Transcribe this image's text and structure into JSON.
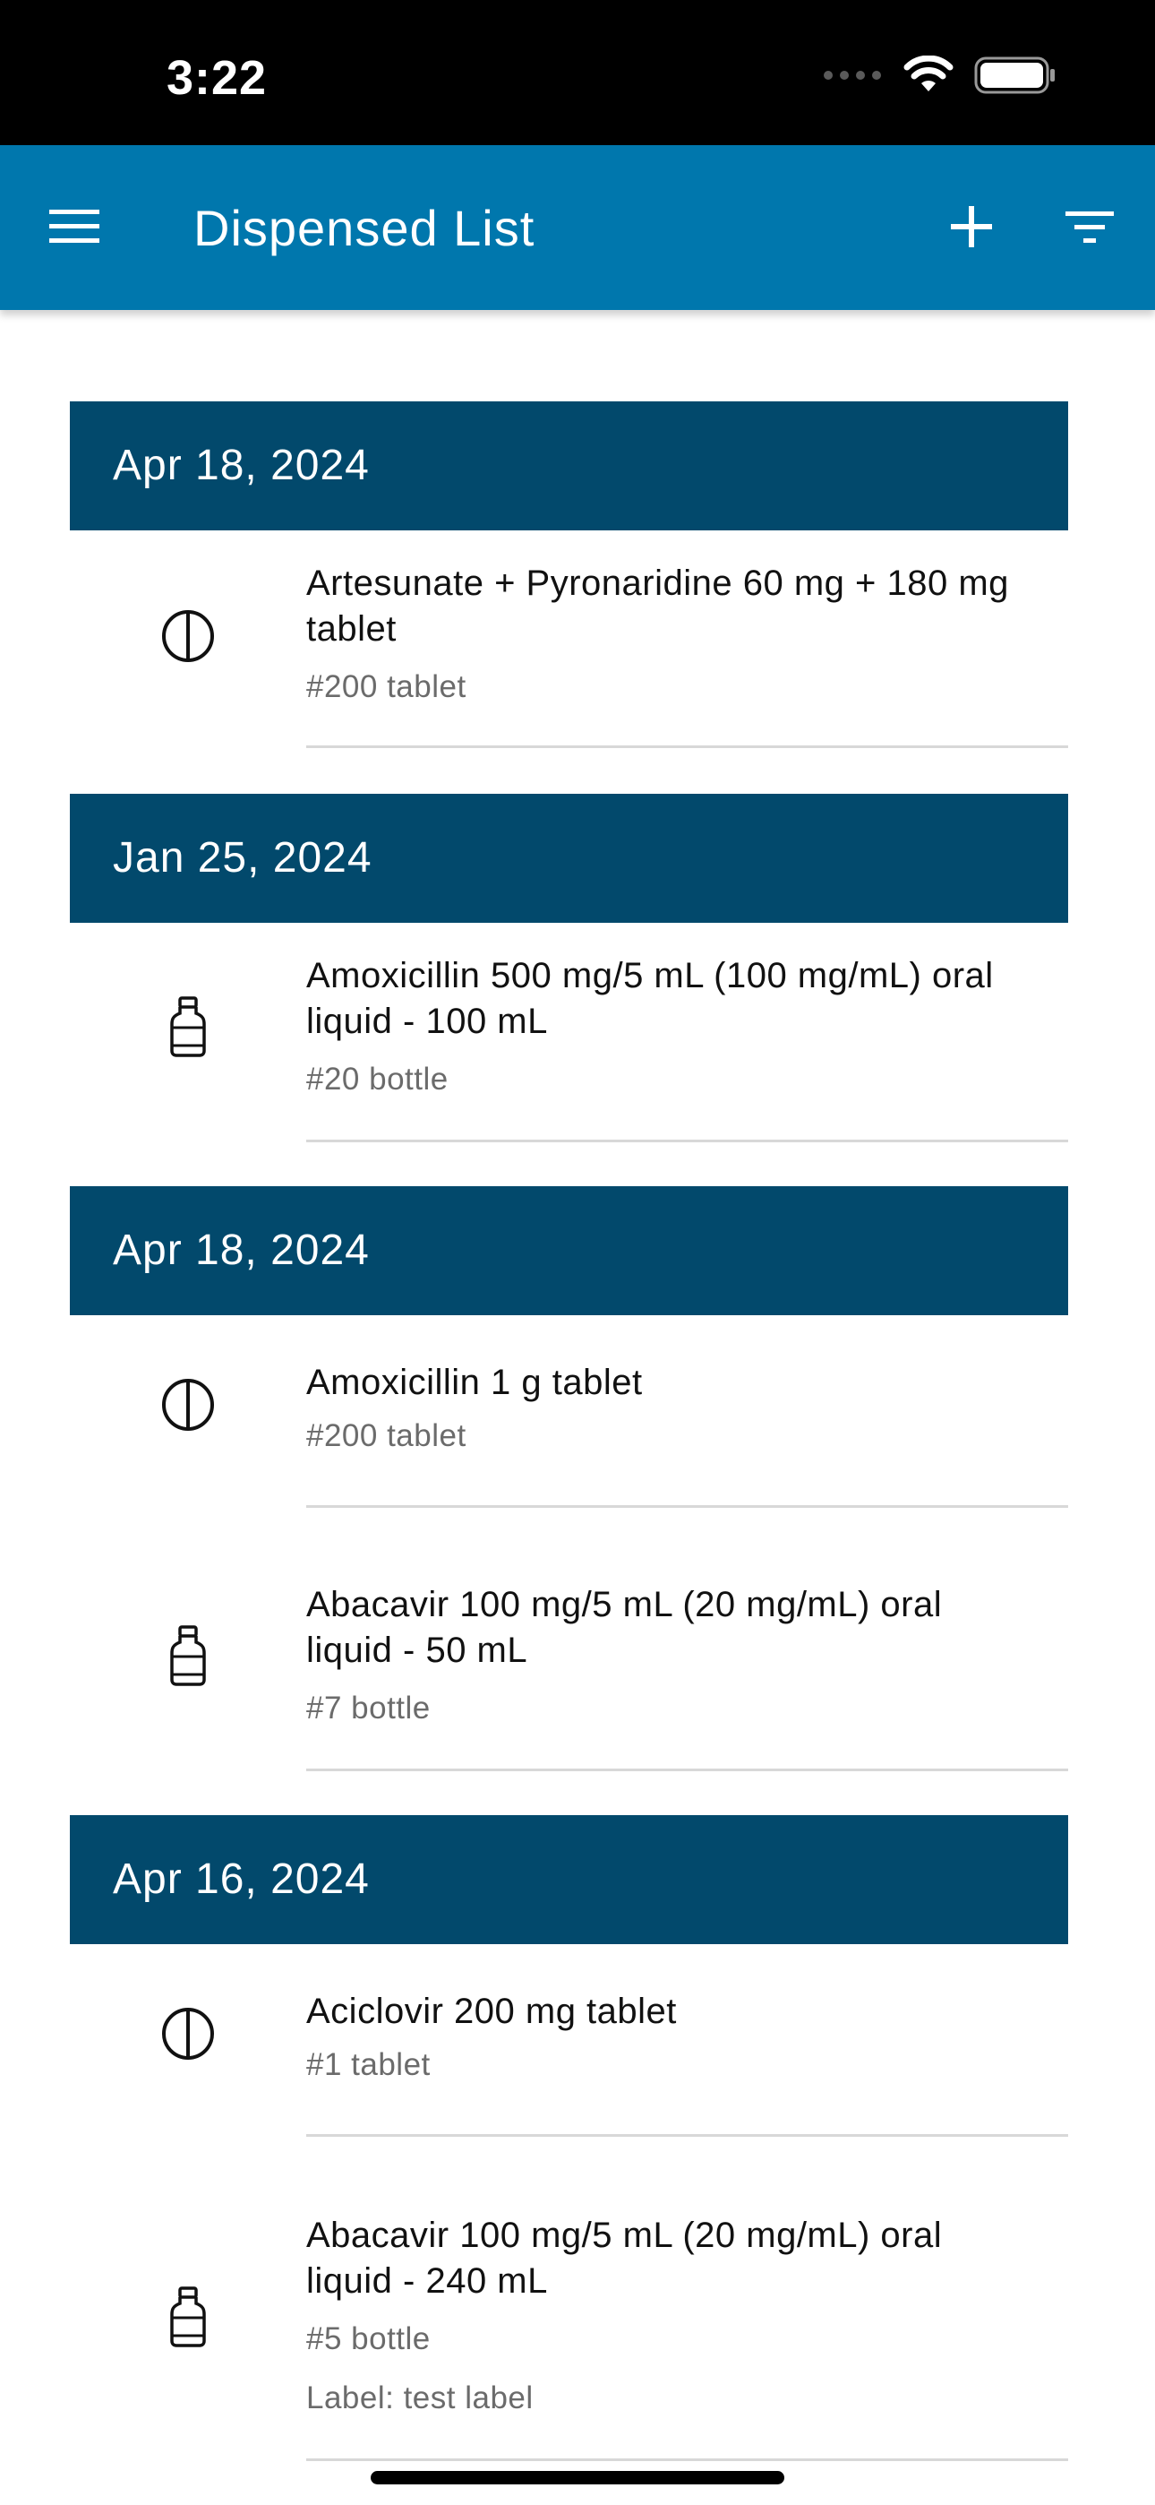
{
  "status_bar": {
    "time": "3:22",
    "icons": [
      "signal-dots-icon",
      "wifi-icon",
      "battery-icon"
    ]
  },
  "app_bar": {
    "title": "Dispensed List",
    "menu_icon": "menu-icon",
    "add_icon": "plus-icon",
    "filter_icon": "filter-icon",
    "color": "#0077ad"
  },
  "colors": {
    "date_header_bg": "#02496c",
    "divider": "#d8d8d8",
    "secondary_text": "#6b6b6b"
  },
  "groups": [
    {
      "date": "Apr 18, 2024",
      "items": [
        {
          "icon": "tablet-icon",
          "name": "Artesunate + Pyronaridine 60 mg + 180 mg tablet",
          "qty": "#200 tablet"
        }
      ]
    },
    {
      "date": "Jan 25, 2024",
      "items": [
        {
          "icon": "bottle-icon",
          "name": "Amoxicillin 500 mg/5 mL (100 mg/mL) oral liquid - 100 mL",
          "qty": "#20 bottle"
        }
      ]
    },
    {
      "date": "Apr 18, 2024",
      "items": [
        {
          "icon": "tablet-icon",
          "name": "Amoxicillin 1 g tablet",
          "qty": "#200 tablet"
        },
        {
          "icon": "bottle-icon",
          "name": "Abacavir 100 mg/5 mL (20 mg/mL) oral liquid - 50 mL",
          "qty": "#7 bottle"
        }
      ]
    },
    {
      "date": "Apr 16, 2024",
      "items": [
        {
          "icon": "tablet-icon",
          "name": "Aciclovir 200 mg tablet",
          "qty": "#1 tablet"
        },
        {
          "icon": "bottle-icon",
          "name": "Abacavir 100 mg/5 mL (20 mg/mL) oral liquid - 240 mL",
          "qty": "#5 bottle",
          "label": "Label: test label"
        }
      ]
    }
  ]
}
